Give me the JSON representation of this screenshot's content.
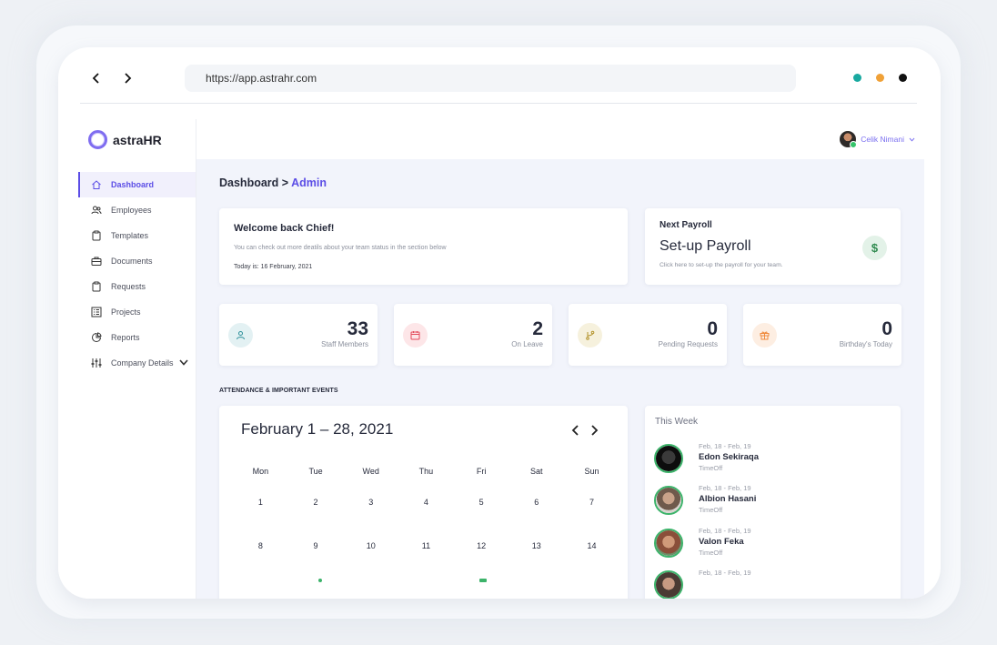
{
  "browser": {
    "url": "https://app.astrahr.com",
    "dots": [
      "#19a9a0",
      "#f0a137",
      "#111111"
    ]
  },
  "sidebar": {
    "brand": "astraHR",
    "items": [
      {
        "label": "Dashboard",
        "icon": "home-icon",
        "active": true
      },
      {
        "label": "Employees",
        "icon": "users-icon"
      },
      {
        "label": "Templates",
        "icon": "clipboard-icon"
      },
      {
        "label": "Documents",
        "icon": "briefcase-icon"
      },
      {
        "label": "Requests",
        "icon": "clipboard-icon"
      },
      {
        "label": "Projects",
        "icon": "list-icon"
      },
      {
        "label": "Reports",
        "icon": "chart-icon"
      },
      {
        "label": "Company Details",
        "icon": "sliders-icon"
      }
    ]
  },
  "header": {
    "user_name": "Celik Nimani"
  },
  "breadcrumb": {
    "root": "Dashboard",
    "separator": ">",
    "current": "Admin"
  },
  "welcome": {
    "title": "Welcome back Chief!",
    "subtitle": "You can check out more deatils about your team status in the section below",
    "date": "Today is: 16 February, 2021"
  },
  "payroll": {
    "label": "Next Payroll",
    "title": "Set-up Payroll",
    "subtitle": "Click here to set-up the payroll for your team.",
    "icon_glyph": "$"
  },
  "stats": [
    {
      "value": "33",
      "label": "Staff Members",
      "icon": "user-icon",
      "bg": "#e3f1f3",
      "fg": "#2c8f9a"
    },
    {
      "value": "2",
      "label": "On Leave",
      "icon": "calendar-icon",
      "bg": "#fde6e8",
      "fg": "#e24b5b"
    },
    {
      "value": "0",
      "label": "Pending Requests",
      "icon": "branch-icon",
      "bg": "#f6f1dd",
      "fg": "#b3922a"
    },
    {
      "value": "0",
      "label": "Birthday's Today",
      "icon": "gift-icon",
      "bg": "#fdeee2",
      "fg": "#f08a3c"
    }
  ],
  "section_title": "ATTENDANCE & IMPORTANT EVENTS",
  "calendar": {
    "title": "February 1 – 28, 2021",
    "weekdays": [
      "Mon",
      "Tue",
      "Wed",
      "Thu",
      "Fri",
      "Sat",
      "Sun"
    ],
    "weeks": [
      [
        "1",
        "2",
        "3",
        "4",
        "5",
        "6",
        "7"
      ],
      [
        "8",
        "9",
        "10",
        "11",
        "12",
        "13",
        "14"
      ]
    ]
  },
  "this_week": {
    "title": "This Week",
    "events": [
      {
        "date": "Feb, 18 - Feb, 19",
        "name": "Edon Sekiraqa",
        "type": "TimeOff"
      },
      {
        "date": "Feb, 18 - Feb, 19",
        "name": "Albion Hasani",
        "type": "TimeOff"
      },
      {
        "date": "Feb, 18 - Feb, 19",
        "name": "Valon Feka",
        "type": "TimeOff"
      },
      {
        "date": "Feb, 18 - Feb, 19",
        "name": "",
        "type": ""
      }
    ]
  }
}
